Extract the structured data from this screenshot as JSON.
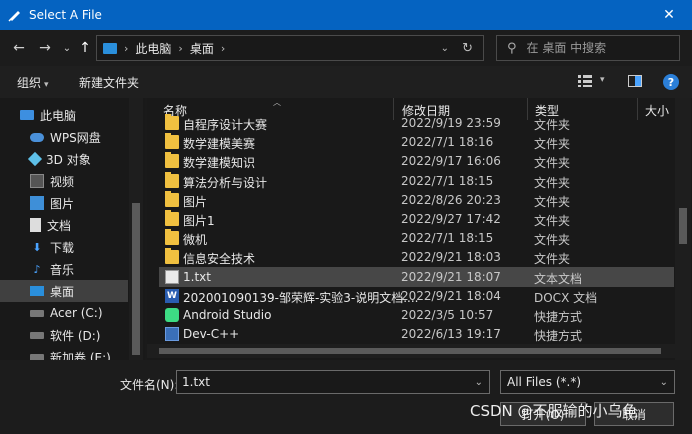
{
  "window": {
    "title": "Select A File",
    "close_glyph": "✕"
  },
  "nav": {
    "back": "←",
    "forward": "→",
    "recent": "⌄",
    "up": "↑"
  },
  "address": {
    "crumbs": [
      "此电脑",
      "桌面"
    ],
    "refresh": "↻",
    "search_placeholder": "在 桌面 中搜索"
  },
  "toolbar": {
    "organize": "组织",
    "new_folder": "新建文件夹",
    "help": "?"
  },
  "sidebar": {
    "items": [
      {
        "label": "此电脑",
        "icon": "computer-icon"
      },
      {
        "label": "WPS网盘",
        "icon": "cloud-icon"
      },
      {
        "label": "3D 对象",
        "icon": "cube-icon"
      },
      {
        "label": "视频",
        "icon": "video-icon"
      },
      {
        "label": "图片",
        "icon": "image-icon"
      },
      {
        "label": "文档",
        "icon": "document-icon"
      },
      {
        "label": "下载",
        "icon": "download-icon"
      },
      {
        "label": "音乐",
        "icon": "music-icon"
      },
      {
        "label": "桌面",
        "icon": "desktop-icon"
      },
      {
        "label": "Acer (C:)",
        "icon": "drive-icon"
      },
      {
        "label": "软件 (D:)",
        "icon": "drive-icon"
      },
      {
        "label": "新加卷 (E:)",
        "icon": "drive-icon"
      }
    ]
  },
  "columns": {
    "name": "名称",
    "modified": "修改日期",
    "type": "类型",
    "size": "大小"
  },
  "files": [
    {
      "name": "自程序设计大赛",
      "date": "2022/9/19 23:59",
      "type": "文件夹",
      "icon": "folder-icon"
    },
    {
      "name": "数学建模美赛",
      "date": "2022/7/1 18:16",
      "type": "文件夹",
      "icon": "folder-icon"
    },
    {
      "name": "数学建模知识",
      "date": "2022/9/17 16:06",
      "type": "文件夹",
      "icon": "folder-icon"
    },
    {
      "name": "算法分析与设计",
      "date": "2022/7/1 18:15",
      "type": "文件夹",
      "icon": "folder-icon"
    },
    {
      "name": "图片",
      "date": "2022/8/26 20:23",
      "type": "文件夹",
      "icon": "folder-icon"
    },
    {
      "name": "图片1",
      "date": "2022/9/27 17:42",
      "type": "文件夹",
      "icon": "folder-icon"
    },
    {
      "name": "微机",
      "date": "2022/7/1 18:15",
      "type": "文件夹",
      "icon": "folder-icon"
    },
    {
      "name": "信息安全技术",
      "date": "2022/9/21 18:03",
      "type": "文件夹",
      "icon": "folder-icon"
    },
    {
      "name": "1.txt",
      "date": "2022/9/21 18:07",
      "type": "文本文档",
      "icon": "text-file-icon"
    },
    {
      "name": "202001090139-邹荣辉-实验3-说明文档....",
      "date": "2022/9/21 18:04",
      "type": "DOCX 文档",
      "icon": "docx-file-icon"
    },
    {
      "name": "Android Studio",
      "date": "2022/3/5 10:57",
      "type": "快捷方式",
      "icon": "android-studio-icon"
    },
    {
      "name": "Dev-C++",
      "date": "2022/6/13 19:17",
      "type": "快捷方式",
      "icon": "dev-cpp-icon"
    }
  ],
  "selected_file": "1.txt",
  "bottom": {
    "filename_label": "文件名(N):",
    "filename_value": "1.txt",
    "filter_value": "All Files (*.*)",
    "open_label": "打开(O)",
    "cancel_label": "取消"
  },
  "watermark": "CSDN @不服输的小乌龟"
}
